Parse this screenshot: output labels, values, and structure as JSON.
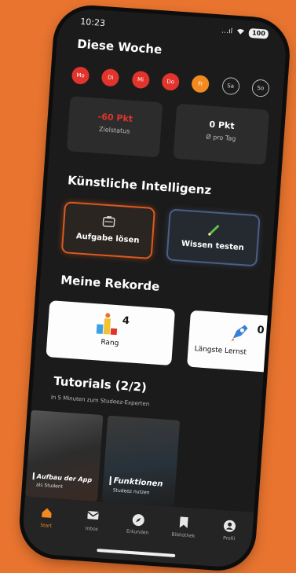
{
  "status_bar": {
    "time": "10:23",
    "signal": "…ıl",
    "battery": "100"
  },
  "week": {
    "title": "Diese Woche",
    "days": [
      {
        "label": "Mo",
        "state": "done"
      },
      {
        "label": "Di",
        "state": "done"
      },
      {
        "label": "Mi",
        "state": "done"
      },
      {
        "label": "Do",
        "state": "done"
      },
      {
        "label": "Fr",
        "state": "today"
      },
      {
        "label": "Sa",
        "state": "open"
      },
      {
        "label": "So",
        "state": "open"
      }
    ],
    "goal": {
      "value": "-60 Pkt",
      "label": "Zielstatus"
    },
    "per_day": {
      "value": "0 Pkt",
      "label": "Ø pro Tag"
    }
  },
  "ai": {
    "title": "Künstliche Intelligenz",
    "solve_label": "Aufgabe lösen",
    "test_label": "Wissen testen"
  },
  "records": {
    "title": "Meine Rekorde",
    "rank": {
      "value": "4",
      "label": "Rang"
    },
    "streak": {
      "value": "0",
      "label": "Längste Lernst"
    }
  },
  "tutorials": {
    "title": "Tutorials (2/2)",
    "subtitle": "In 5 Minuten zum Studeez-Experten",
    "videos": [
      {
        "title": "Aufbau der App",
        "subtitle": "als Student"
      },
      {
        "title": "Funktionen",
        "subtitle": "Studeez nutzen"
      }
    ]
  },
  "tabs": [
    {
      "label": "Start",
      "icon": "home-icon",
      "active": true
    },
    {
      "label": "Inbox",
      "icon": "mail-icon",
      "active": false
    },
    {
      "label": "Erkunden",
      "icon": "compass-icon",
      "active": false
    },
    {
      "label": "Bibliothek",
      "icon": "bookmark-icon",
      "active": false
    },
    {
      "label": "Profil",
      "icon": "user-icon",
      "active": false
    }
  ],
  "colors": {
    "background": "#E8742F",
    "accent": "#F28A20",
    "done_day": "#E0342C",
    "ai_solve_border": "#D95A20",
    "ai_test_border": "#4A5F86"
  }
}
